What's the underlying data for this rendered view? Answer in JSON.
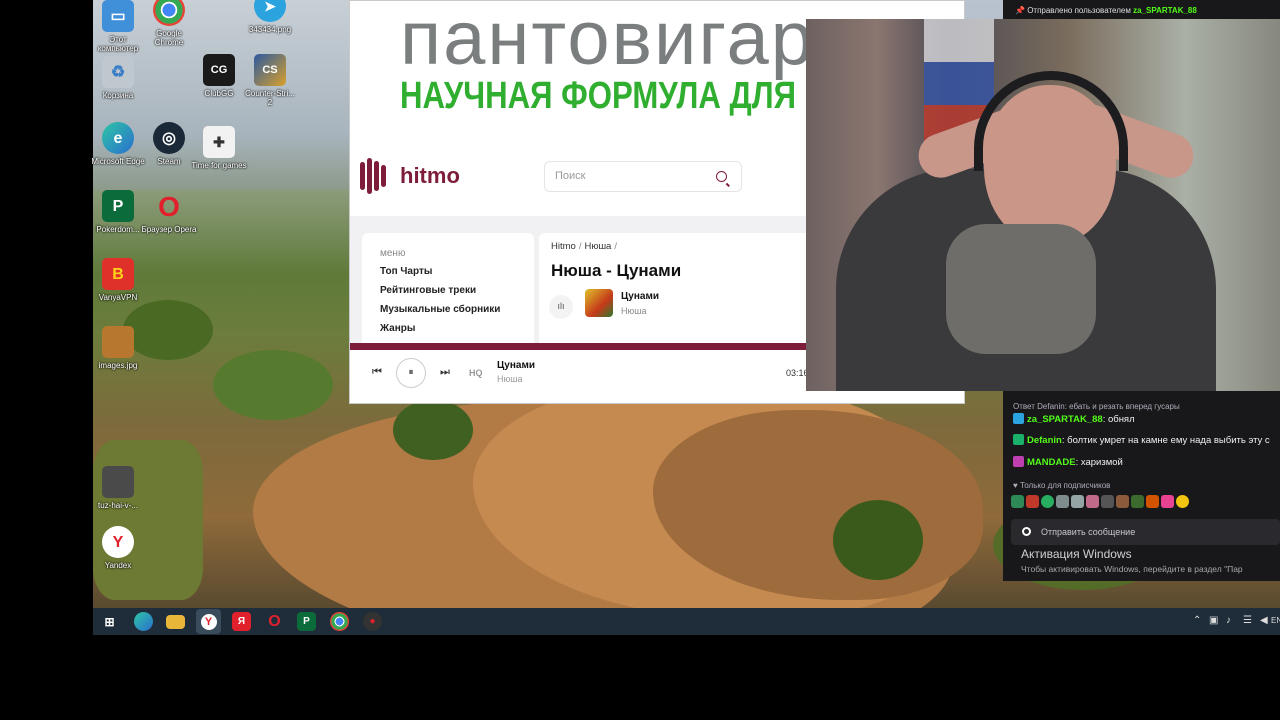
{
  "desktop": {
    "icons": [
      {
        "label": "Этот компьютер",
        "icon": "this-pc-icon",
        "color": "#3f8fd9",
        "glyph": "▭"
      },
      {
        "label": "Google Chrome",
        "icon": "chrome-icon",
        "color": "#e8e8e8",
        "glyph": "◉"
      },
      {
        "label": "343434.png",
        "icon": "telegram-icon",
        "color": "#2aa3df",
        "glyph": "➤"
      },
      {
        "label": "Корзина",
        "icon": "recycle-bin-icon",
        "color": "#bfc7cf",
        "glyph": "♻"
      },
      {
        "label": "ClubGG",
        "icon": "clubgg-icon",
        "color": "#1a1a1a",
        "glyph": "CG"
      },
      {
        "label": "Counter-Stri... 2",
        "icon": "counter-strike-icon",
        "color": "#d9a02a",
        "glyph": "CS"
      },
      {
        "label": "Microsoft Edge",
        "icon": "edge-icon",
        "color": "#2a8cd0",
        "glyph": "e"
      },
      {
        "label": "Steam",
        "icon": "steam-icon",
        "color": "#1b2838",
        "glyph": "◎"
      },
      {
        "label": "Time for games",
        "icon": "gamepad-icon",
        "color": "#f2f2f2",
        "glyph": "🎮"
      },
      {
        "label": "Pokerdom...",
        "icon": "pokerdom-icon",
        "color": "#0b6b3a",
        "glyph": "P"
      },
      {
        "label": "Браузер Opera",
        "icon": "opera-icon",
        "color": "#ffffff",
        "glyph": "O"
      },
      {
        "label": "VanyaVPN",
        "icon": "vpn-icon",
        "color": "#e0302a",
        "glyph": "B"
      },
      {
        "label": "images.jpg",
        "icon": "image-file-icon",
        "color": "#b7772f",
        "glyph": ""
      },
      {
        "label": "tuz-hai-v-...",
        "icon": "image-file-icon",
        "color": "#4a4a4a",
        "glyph": ""
      },
      {
        "label": "Yandex",
        "icon": "yandex-browser-icon",
        "color": "#ffffff",
        "glyph": "Y"
      }
    ]
  },
  "browser": {
    "banner_line1": "пантовигар",
    "banner_line2": "НАУЧНАЯ ФОРМУЛА ДЛЯ",
    "logo": "hitmo",
    "search_placeholder": "Поиск",
    "menu": {
      "heading": "меню",
      "items": [
        "Топ Чарты",
        "Рейтинговые треки",
        "Музыкальные сборники",
        "Жанры"
      ]
    },
    "breadcrumb": [
      "Hitmo",
      "Нюша"
    ],
    "breadcrumb_sep": "/",
    "page_title": "Нюша - Цунами",
    "track": {
      "name": "Цунами",
      "artist": "Нюша",
      "eq": "ılı"
    },
    "player": {
      "hq_label": "HQ",
      "track_name": "Цунами",
      "artist": "Нюша",
      "time": "03:16",
      "prev": "⏮",
      "pause": "⏸",
      "next": "⏭"
    }
  },
  "chat": {
    "pinned_prefix": "Отправлено пользователем",
    "pinned_user": "za_SPARTAK_88",
    "reply_text": "Ответ Defanin: ебать и резать вперед гусары",
    "messages": [
      {
        "user": "za_SPARTAK_88",
        "text": ": обнял",
        "color": "#53fc18",
        "badge": "#2aa3df"
      },
      {
        "user": "Defanin",
        "text": ": болтик умрет на камне ему нада выбить эту с",
        "color": "#53fc18",
        "badge": "#1bb06a"
      },
      {
        "user": "MANDADE",
        "text": ": харизмой",
        "color": "#53fc18",
        "badge": "#c03fb0"
      }
    ],
    "subs_only": "Только для подписчиков",
    "send_placeholder": "Отправить сообщение",
    "activation_title": "Активация Windows",
    "activation_text": "Чтобы активировать Windows, перейдите в раздел \"Пар"
  },
  "taskbar": {
    "tray_lang": "EN"
  }
}
